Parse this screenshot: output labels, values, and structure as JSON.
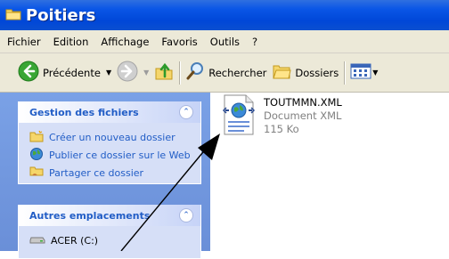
{
  "window": {
    "title": "Poitiers"
  },
  "menu": [
    "Fichier",
    "Edition",
    "Affichage",
    "Favoris",
    "Outils",
    "?"
  ],
  "toolbar": {
    "back_label": "Précédente",
    "search_label": "Rechercher",
    "folders_label": "Dossiers"
  },
  "file_tasks": {
    "title": "Gestion des fichiers",
    "items": [
      {
        "label": "Créer un nouveau dossier",
        "icon": "new-folder-icon"
      },
      {
        "label": "Publier ce dossier sur le Web",
        "icon": "web-publish-icon"
      },
      {
        "label": "Partager ce dossier",
        "icon": "share-folder-icon"
      }
    ]
  },
  "other_places": {
    "title": "Autres emplacements",
    "items": [
      {
        "label": "ACER (C:)",
        "icon": "drive-icon"
      }
    ]
  },
  "file": {
    "name": "TOUTMMN.XML",
    "type": "Document XML",
    "size": "115 Ko",
    "icon": "xml-document-icon"
  },
  "colors": {
    "titlebar": "#0a56e6",
    "task_link": "#215dc6",
    "pane": "#6a8fd8"
  }
}
